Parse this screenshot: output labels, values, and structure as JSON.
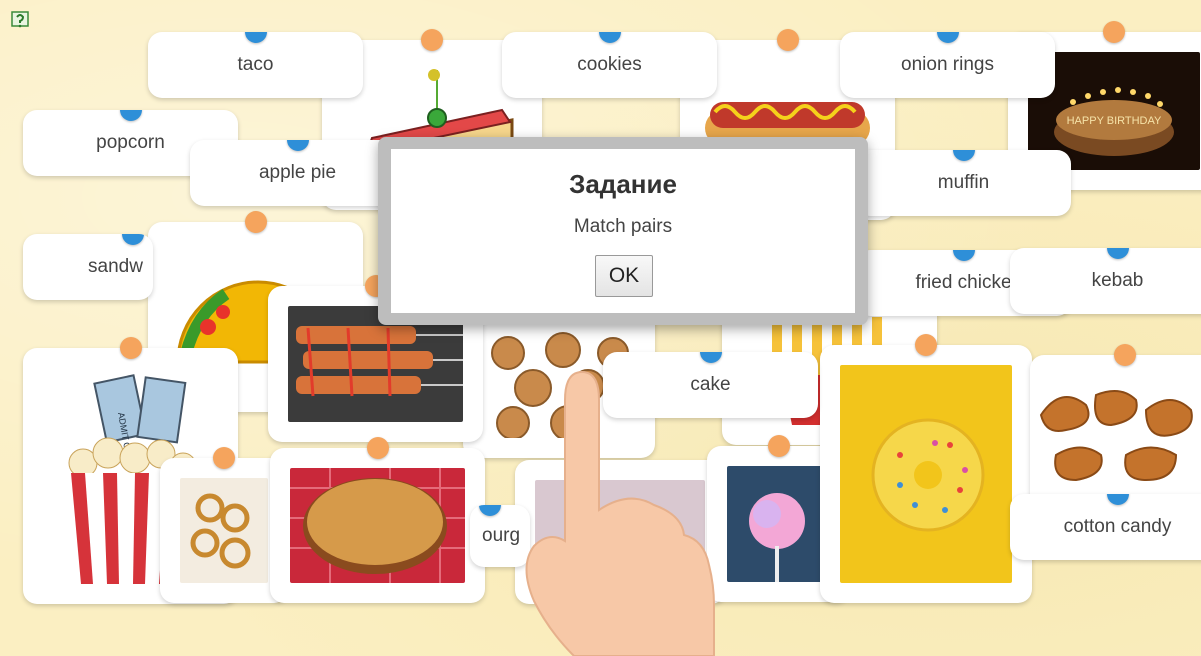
{
  "app": {
    "help_icon": "help-question-icon"
  },
  "dialog": {
    "title": "Задание",
    "message": "Match pairs",
    "ok_label": "OK"
  },
  "word_cards": [
    {
      "id": "taco",
      "label": "taco"
    },
    {
      "id": "cookies",
      "label": "cookies"
    },
    {
      "id": "onion-rings",
      "label": "onion rings"
    },
    {
      "id": "popcorn",
      "label": "popcorn"
    },
    {
      "id": "apple-pie",
      "label": "apple pie"
    },
    {
      "id": "muffin",
      "label": "muffin"
    },
    {
      "id": "sandwich",
      "label": "sandw"
    },
    {
      "id": "fried-chicken",
      "label": "fried chicke"
    },
    {
      "id": "kebab",
      "label": "kebab"
    },
    {
      "id": "cake",
      "label": "cake"
    },
    {
      "id": "cotton-candy",
      "label": "cotton candy"
    },
    {
      "id": "burger",
      "label": "ourg"
    }
  ],
  "picture_cards": [
    {
      "id": "sandwich-picture",
      "icon": "sandwich-image"
    },
    {
      "id": "hotdog-picture",
      "icon": "hotdog-image"
    },
    {
      "id": "birthday-cake-picture",
      "icon": "birthday-cake-image",
      "caption": "HAPPY BIRTHDAY"
    },
    {
      "id": "taco-picture",
      "icon": "taco-image"
    },
    {
      "id": "kebab-picture",
      "icon": "kebab-image"
    },
    {
      "id": "cookies-picture",
      "icon": "cookies-image"
    },
    {
      "id": "fries-picture",
      "icon": "fries-image"
    },
    {
      "id": "popcorn-picture",
      "icon": "popcorn-image",
      "ticket_text": "ADMIT ONE"
    },
    {
      "id": "onion-rings-picture",
      "icon": "onion-rings-image"
    },
    {
      "id": "apple-pie-picture",
      "icon": "apple-pie-image"
    },
    {
      "id": "muffin-picture",
      "icon": "muffin-image"
    },
    {
      "id": "cotton-candy-picture",
      "icon": "cotton-candy-image"
    },
    {
      "id": "donut-picture",
      "icon": "donut-image"
    },
    {
      "id": "fried-chicken-picture",
      "icon": "fried-chicken-image"
    }
  ],
  "colors": {
    "background": "#fbefc2",
    "pin_word": "#2e8fd8",
    "pin_picture": "#f5a45d"
  }
}
